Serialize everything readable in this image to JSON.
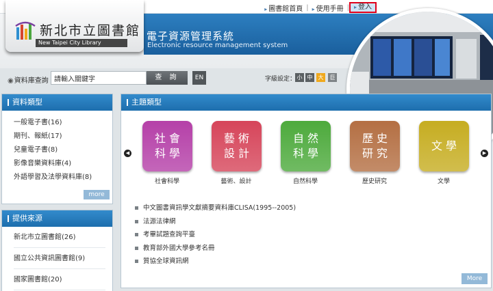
{
  "header": {
    "top_links": [
      "圖書館首頁",
      "使用手冊"
    ],
    "login_label": "登入",
    "logo_cn": "新北市立圖書館",
    "logo_en": "New Taipei City Library",
    "system_title": "電子資源管理系統",
    "system_subtitle": "Electronic resource management system"
  },
  "search": {
    "label": "資料庫查詢",
    "input_value": "請輸入關鍵字",
    "button_label": "查 詢",
    "en_label": "EN",
    "font_label": "字級設定：",
    "font_sizes": [
      "小",
      "中",
      "大",
      "巨"
    ]
  },
  "type_panel": {
    "title": "資料類型",
    "items": [
      "一般電子書(16)",
      "期刊、報紙(17)",
      "兒童電子書(8)",
      "影像音樂資料庫(4)",
      "外語學習及法學資料庫(8)"
    ],
    "more_label": "more"
  },
  "source_panel": {
    "title": "提供來源",
    "items": [
      "新北市立圖書館(26)",
      "國立公共資訊圖書館(9)",
      "國家圖書館(20)"
    ]
  },
  "subject_panel": {
    "title": "主題類型",
    "tiles": [
      {
        "text": "社會\n科學",
        "caption": "社會科學",
        "color": "#b540a8"
      },
      {
        "text": "藝術\n設計",
        "caption": "藝術、設計",
        "color": "#d6455a"
      },
      {
        "text": "自然\n科學",
        "caption": "自然科學",
        "color": "#4daa3c"
      },
      {
        "text": "歷史\n研究",
        "caption": "歷史研究",
        "color": "#b46f43"
      },
      {
        "text": "文學",
        "caption": "文學",
        "color": "#c6ad21"
      }
    ],
    "links": [
      "中文圖書資訊學文獻摘要資料庫CLISA(1995--2005)",
      "法源法律網",
      "考畢試題查詢平臺",
      "教育部外國大學參考名冊",
      "質協全球資訊網"
    ],
    "more_label": "More"
  }
}
